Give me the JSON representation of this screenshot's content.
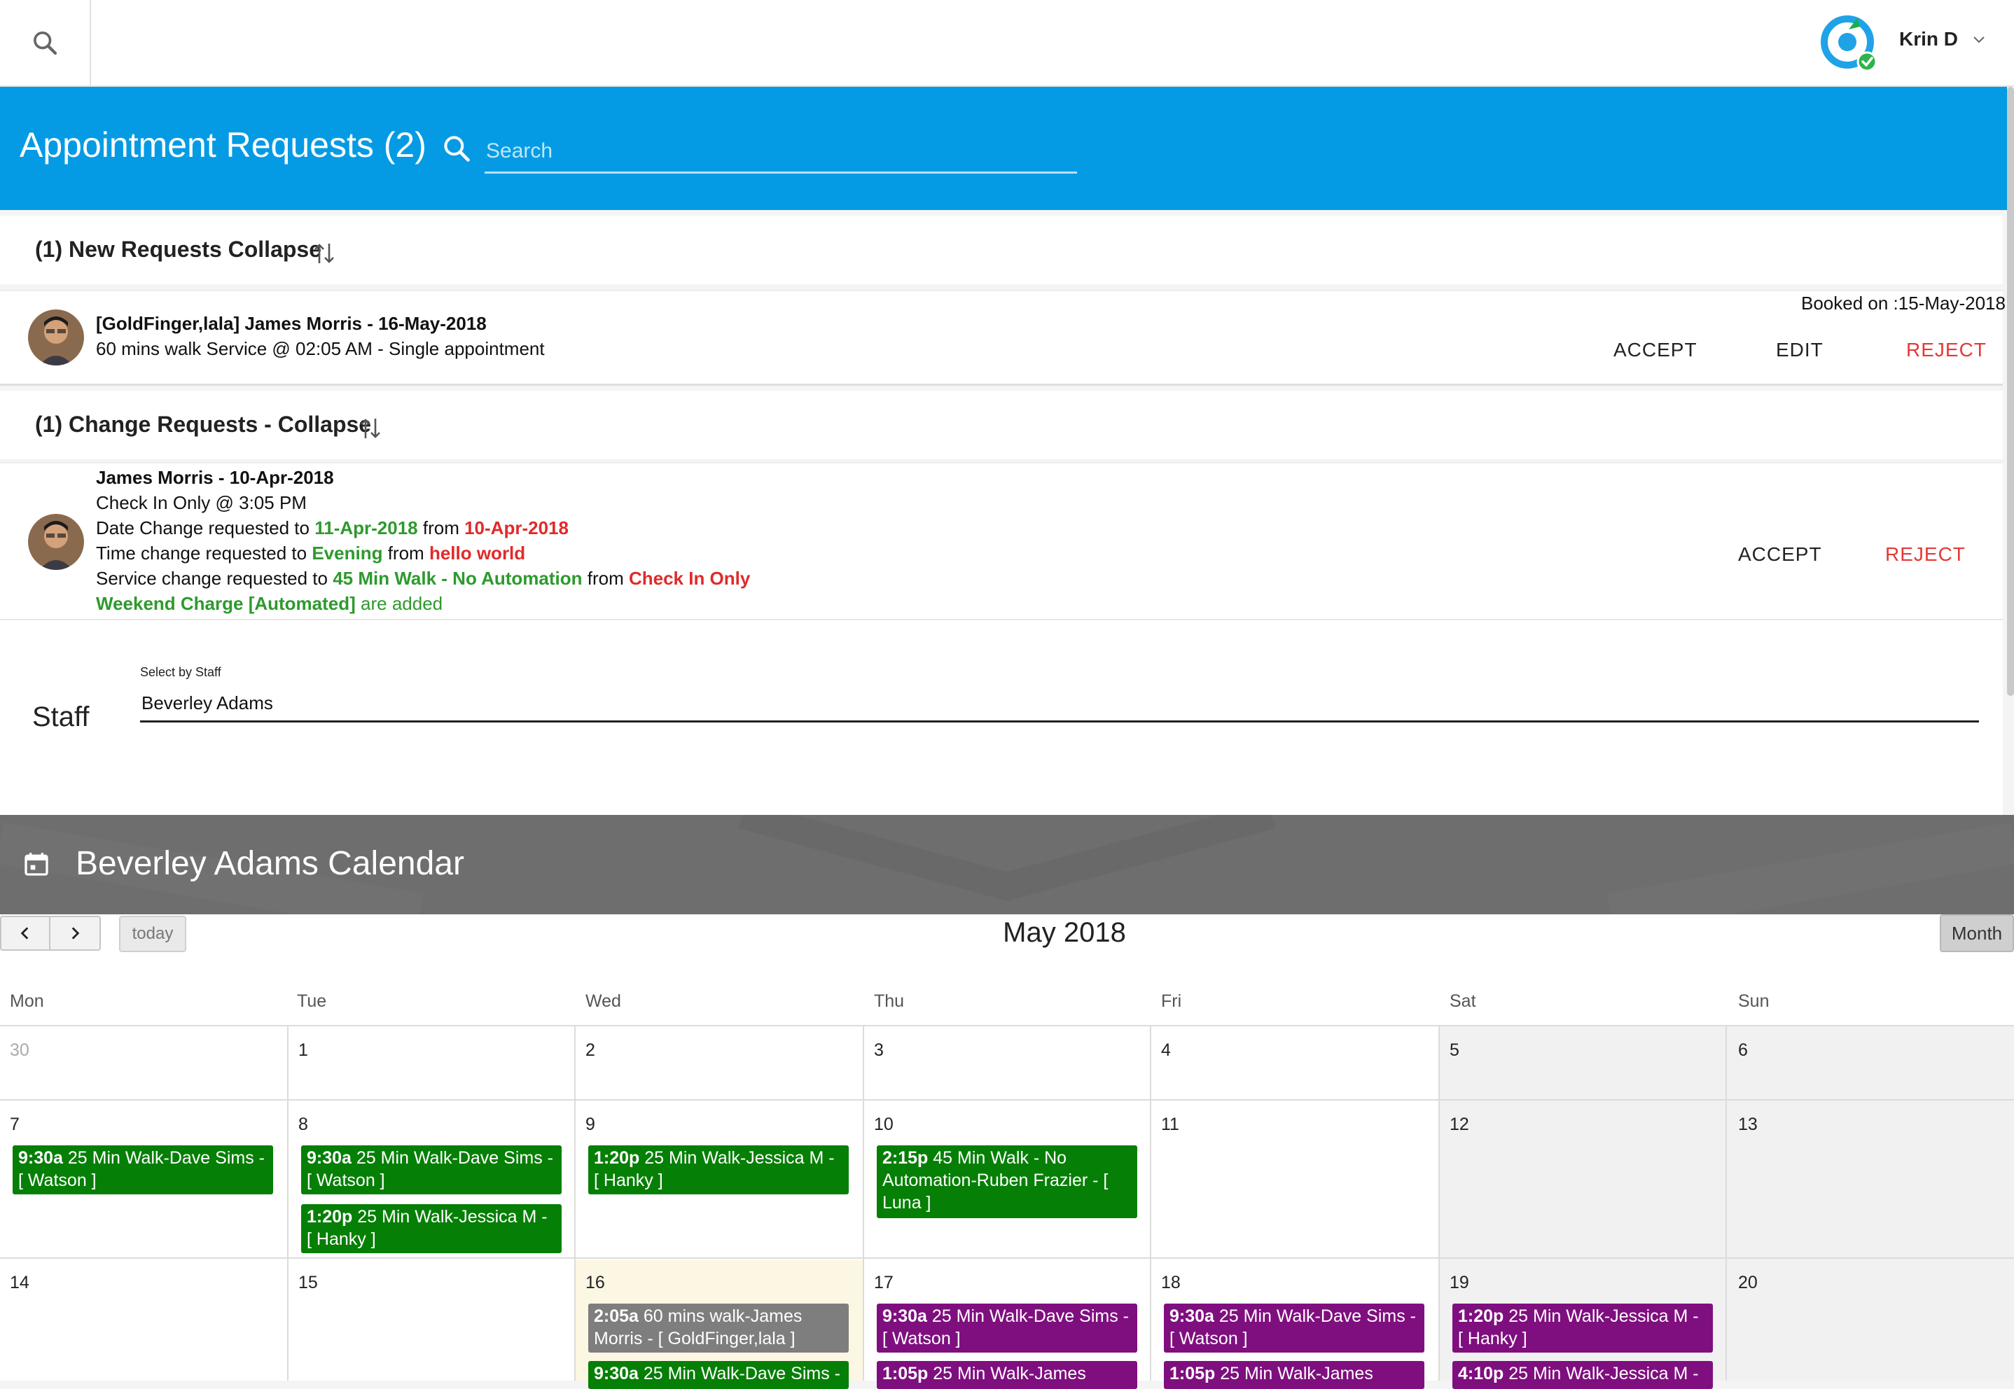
{
  "topbar": {
    "user_name": "Krin D"
  },
  "header": {
    "title": "Appointment Requests (2)",
    "search_placeholder": "Search"
  },
  "new_requests": {
    "title": "(1) New Requests Collapse",
    "item": {
      "line1": "[GoldFinger,lala] James Morris - 16-May-2018",
      "line2": "60 mins walk Service @ 02:05 AM - Single appointment",
      "booked_on": "Booked on :15-May-2018",
      "accept": "ACCEPT",
      "edit": "EDIT",
      "reject": "REJECT"
    }
  },
  "change_requests": {
    "title": "(1) Change Requests - Collapse",
    "item": {
      "name": "James  Morris - 10-Apr-2018",
      "checkin": "Check In Only @ 3:05 PM",
      "date_pre": "Date Change requested to ",
      "date_new": "11-Apr-2018",
      "date_mid": " from ",
      "date_old": "10-Apr-2018",
      "time_pre": "Time change requested to ",
      "time_new": "Evening",
      "time_mid": " from ",
      "time_old": "hello world",
      "svc_pre": "Service change requested to ",
      "svc_new": "45 Min Walk - No Automation",
      "svc_mid": " from ",
      "svc_old": "Check In Only",
      "extra_bold": "Weekend Charge [Automated]",
      "extra_rest": " are added",
      "accept": "ACCEPT",
      "reject": "REJECT"
    }
  },
  "staff": {
    "label": "Staff",
    "field_label": "Select by Staff",
    "value": "Beverley Adams"
  },
  "calendar": {
    "title": "Beverley Adams Calendar",
    "today": "today",
    "month_btn": "Month",
    "month_title": "May 2018",
    "days_of_week": [
      "Mon",
      "Tue",
      "Wed",
      "Thu",
      "Fri",
      "Sat",
      "Sun"
    ],
    "weeks": [
      [
        "30",
        "1",
        "2",
        "3",
        "4",
        "5",
        "6"
      ],
      [
        "7",
        "8",
        "9",
        "10",
        "11",
        "12",
        "13"
      ],
      [
        "14",
        "15",
        "16",
        "17",
        "18",
        "19",
        "20"
      ]
    ],
    "events": {
      "w1_mon": {
        "time": "9:30a",
        "text": " 25 Min Walk-Dave Sims - [ Watson ]"
      },
      "w1_tue_1": {
        "time": "9:30a",
        "text": " 25 Min Walk-Dave Sims - [ Watson ]"
      },
      "w1_tue_2": {
        "time": "1:20p",
        "text": " 25 Min Walk-Jessica M - [ Hanky ]"
      },
      "w1_wed": {
        "time": "1:20p",
        "text": " 25 Min Walk-Jessica M - [ Hanky ]"
      },
      "w1_thu": {
        "time": "2:15p",
        "text": " 45 Min Walk - No Automation-Ruben Frazier - [ Luna ]"
      },
      "w2_wed_1": {
        "time": "2:05a",
        "text": " 60 mins walk-James Morris - [ GoldFinger,lala ]"
      },
      "w2_wed_2": {
        "time": "9:30a",
        "text": " 25 Min Walk-Dave Sims -"
      },
      "w2_thu_1": {
        "time": "9:30a",
        "text": " 25 Min Walk-Dave Sims - [ Watson ]"
      },
      "w2_thu_2": {
        "time": "1:05p",
        "text": " 25 Min Walk-James"
      },
      "w2_fri_1": {
        "time": "9:30a",
        "text": " 25 Min Walk-Dave Sims - [ Watson ]"
      },
      "w2_fri_2": {
        "time": "1:05p",
        "text": " 25 Min Walk-James"
      },
      "w2_sat_1": {
        "time": "1:20p",
        "text": " 25 Min Walk-Jessica M - [ Hanky ]"
      },
      "w2_sat_2": {
        "time": "4:10p",
        "text": " 25 Min Walk-Jessica M -"
      }
    }
  }
}
